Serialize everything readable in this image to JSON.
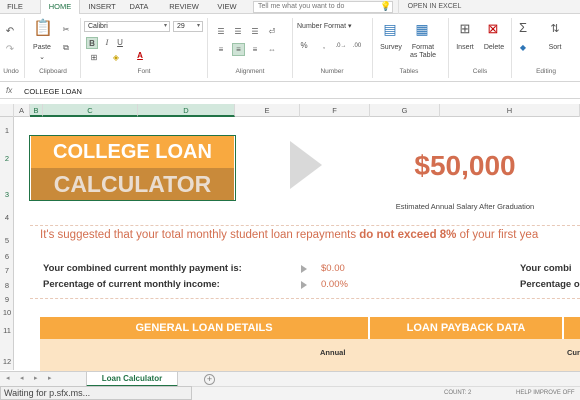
{
  "ribbon_tabs": [
    "FILE",
    "HOME",
    "INSERT",
    "DATA",
    "REVIEW",
    "VIEW"
  ],
  "tell_me": "Tell me what you want to do",
  "open_in_excel": "OPEN IN EXCEL",
  "clipboard": {
    "undo": "Undo",
    "paste": "Paste",
    "group": "Clipboard"
  },
  "font": {
    "name": "Calibri",
    "size": "29",
    "group": "Font"
  },
  "alignment": {
    "group": "Alignment"
  },
  "number": {
    "format": "Number Format",
    "group": "Number"
  },
  "tables": {
    "survey": "Survey",
    "format_as_table": "Format\nas Table",
    "group": "Tables"
  },
  "cells": {
    "insert": "Insert",
    "delete": "Delete",
    "group": "Cells"
  },
  "editing": {
    "sort": "Sort",
    "group": "Editing"
  },
  "formula_bar": {
    "fx": "fx",
    "value": "COLLEGE LOAN"
  },
  "columns": [
    "A",
    "B",
    "C",
    "D",
    "E",
    "F",
    "G",
    "H"
  ],
  "rows": [
    "1",
    "2",
    "3",
    "4",
    "5",
    "6",
    "7",
    "8",
    "9",
    "10",
    "11",
    "12"
  ],
  "sheet": {
    "title_line1": "COLLEGE LOAN",
    "title_line2": "CALCULATOR",
    "salary": "$50,000",
    "salary_caption": "Estimated Annual Salary After Graduation",
    "suggest_pre": "It's suggested that your total monthly student loan repayments ",
    "suggest_bold": "do not exceed 8%",
    "suggest_post": " of your first yea",
    "monthly_payment_label": "Your combined current monthly payment is:",
    "monthly_payment_value": "$0.00",
    "income_pct_label": "Percentage of current monthly income:",
    "income_pct_value": "0.00%",
    "right_label_1": "Your combi",
    "right_label_2": "Percentage o",
    "general_header": "GENERAL LOAN DETAILS",
    "payback_header": "LOAN PAYBACK DATA",
    "annual_label": "Annual",
    "cur_label": "Cur"
  },
  "sheet_tab": "Loan Calculator",
  "status": {
    "waiting": "Waiting for p.sfx.ms...",
    "count": "COUNT: 2",
    "help": "HELP IMPROVE OFF"
  },
  "colors": {
    "orange": "#f8a940",
    "dark_orange": "#c98a3a",
    "salmon": "#d36e4f",
    "excel_green": "#217346"
  }
}
